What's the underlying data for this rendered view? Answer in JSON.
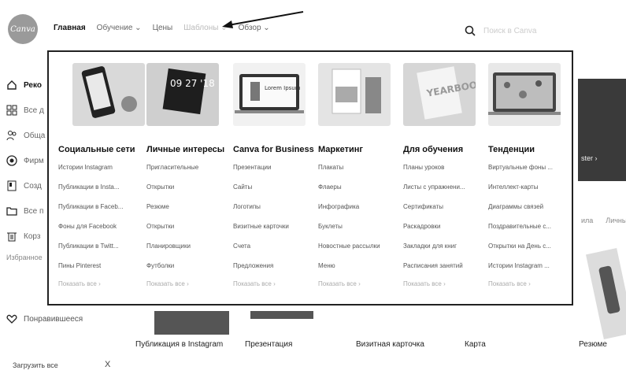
{
  "header": {
    "logo_text": "Canva",
    "nav": [
      "Главная",
      "Обучение ⌄",
      "Цены",
      "Шаблоны ⌄",
      "Обзор ⌄"
    ],
    "search_placeholder": "Поиск в Canva"
  },
  "sidebar": {
    "items": [
      {
        "label": "Реко",
        "icon": "home-icon",
        "bold": true
      },
      {
        "label": "Все д",
        "icon": "grid-icon"
      },
      {
        "label": "Обща",
        "icon": "people-icon"
      },
      {
        "label": "Фирм",
        "icon": "brand-icon"
      },
      {
        "label": "Созд",
        "icon": "document-icon"
      },
      {
        "label": "Все п",
        "icon": "folder-icon"
      },
      {
        "label": "Корз",
        "icon": "trash-icon"
      }
    ],
    "section_label": "Избранное",
    "liked_label": "Понравившееся"
  },
  "mega_menu": {
    "columns": [
      {
        "title": "Социальные сети",
        "items": [
          "Истории Instagram",
          "Публикации в Insta...",
          "Публикации в Faceb...",
          "Фоны для Facebook",
          "Публикации в Twitt...",
          "Пины Pinterest"
        ],
        "more": "Показать все ›"
      },
      {
        "title": "Личные интересы",
        "items": [
          "Пригласительные",
          "Открытки",
          "Резюме",
          "Открытки",
          "Планировщики",
          "Футболки"
        ],
        "more": "Показать все ›"
      },
      {
        "title": "Canva for Business",
        "items": [
          "Презентации",
          "Сайты",
          "Логотипы",
          "Визитные карточки",
          "Счета",
          "Предложения"
        ],
        "more": "Показать все ›"
      },
      {
        "title": "Маркетинг",
        "items": [
          "Плакаты",
          "Флаеры",
          "Инфографика",
          "Буклеты",
          "Новостные рассылки",
          "Меню"
        ],
        "more": "Показать все ›"
      },
      {
        "title": "Для обучения",
        "items": [
          "Планы уроков",
          "Листы с упражнени...",
          "Сертификаты",
          "Раскадровки",
          "Закладки для книг",
          "Расписания занятий"
        ],
        "more": "Показать все ›"
      },
      {
        "title": "Тенденции",
        "items": [
          "Виртуальные фоны ...",
          "Интеллект-карты",
          "Диаграммы связей",
          "Поздравительные с...",
          "Открытки на День с...",
          "Истории Instagram ..."
        ],
        "more": "Показать все ›"
      }
    ],
    "thumbs": [
      "social-thumb",
      "personal-thumb",
      "business-thumb",
      "marketing-thumb",
      "education-thumb",
      "trends-thumb"
    ],
    "thumb_text": {
      "date": "09 27 '18",
      "poster": "Lorem Ipsum",
      "yearbook": "YEARBOOK"
    }
  },
  "background": {
    "right_text": "ster ›",
    "right_row": [
      "ила",
      "Личные"
    ],
    "bottom_labels": [
      "Публикация в Instagram",
      "Презентация",
      "Визитная карточка",
      "Карта",
      "Резюме"
    ],
    "footer_text": "Загрузить все",
    "footer_close": "X"
  }
}
